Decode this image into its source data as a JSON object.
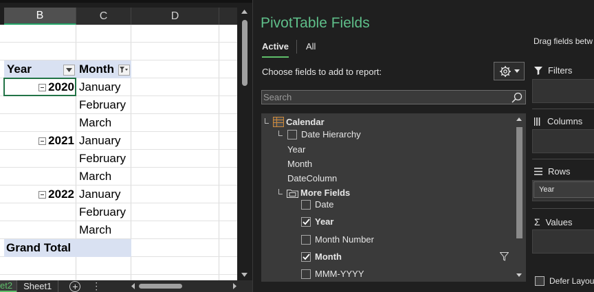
{
  "sheet": {
    "columns": [
      "B",
      "C",
      "D"
    ],
    "header": {
      "year": "Year",
      "month": "Month"
    },
    "rows": [
      {
        "year": "2020",
        "month": "January"
      },
      {
        "year": "",
        "month": "February"
      },
      {
        "year": "",
        "month": "March"
      },
      {
        "year": "2021",
        "month": "January"
      },
      {
        "year": "",
        "month": "February"
      },
      {
        "year": "",
        "month": "March"
      },
      {
        "year": "2022",
        "month": "January"
      },
      {
        "year": "",
        "month": "February"
      },
      {
        "year": "",
        "month": "March"
      }
    ],
    "grand_total": "Grand Total",
    "tabs": {
      "active": "et2",
      "other": "Sheet1"
    }
  },
  "pivot": {
    "title": "PivotTable Fields",
    "tab_active": "Active",
    "tab_all": "All",
    "choose": "Choose fields to add to report:",
    "search_placeholder": "Search",
    "tree": {
      "table": "Calendar",
      "date_hierarchy": "Date Hierarchy",
      "year": "Year",
      "month": "Month",
      "date_column": "DateColumn",
      "more_fields": "More Fields",
      "fields": [
        {
          "label": "Date",
          "checked": false,
          "bold": false
        },
        {
          "label": "Year",
          "checked": true,
          "bold": true
        },
        {
          "label": "Month Number",
          "checked": false,
          "bold": false
        },
        {
          "label": "Month",
          "checked": true,
          "bold": true
        },
        {
          "label": "MMM-YYYY",
          "checked": false,
          "bold": false
        }
      ]
    },
    "drag_text": "Drag fields betw",
    "areas": {
      "filters": "Filters",
      "columns": "Columns",
      "rows": "Rows",
      "values": "Values",
      "row_field": "Year"
    },
    "defer": "Defer Layou"
  },
  "colors": {
    "accent_green": "#5fbf6a",
    "header_fill": "#d9e1f2",
    "pane_bg": "#1f1f1f"
  }
}
